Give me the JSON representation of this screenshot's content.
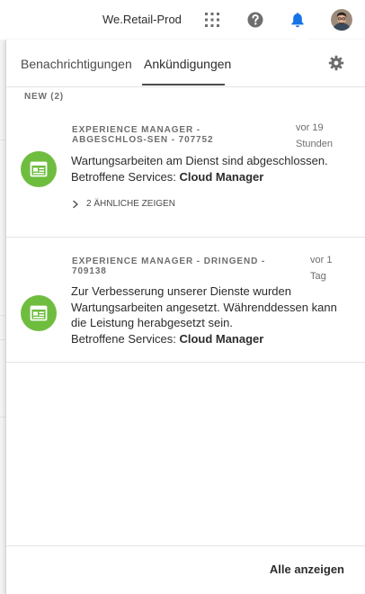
{
  "header": {
    "org_name": "We.Retail-Prod",
    "icons": [
      "apps-grid-icon",
      "help-icon",
      "bell-icon",
      "user-avatar"
    ],
    "bell_color": "#1473e6"
  },
  "popover": {
    "tabs": [
      {
        "label": "Benachrichtigungen",
        "active": false
      },
      {
        "label": "Ankündigungen",
        "active": true
      }
    ],
    "settings_icon": "gear-icon",
    "section_label": "NEW (2)",
    "notifications": [
      {
        "title": "EXPERIENCE MANAGER - ABGESCHLOS-SEN - 707752",
        "time": "vor 19 Stunden",
        "message": "Wartungsarbeiten am Dienst sind abgeschlossen.",
        "services_label": "Betroffene Services: ",
        "services_value": "Cloud Manager",
        "similar_label": "2 ÄHNLICHE ZEIGEN",
        "icon": "announcement-icon"
      },
      {
        "title": "EXPERIENCE MANAGER - DRINGEND - 709138",
        "time": "vor 1 Tag",
        "message": "Zur Verbesserung unserer Dienste wurden Wartungsarbeiten angesetzt. Währenddessen kann die Leistung herabgesetzt sein.",
        "services_label": "Betroffene Services: ",
        "services_value": "Cloud Manager",
        "icon": "announcement-icon"
      }
    ],
    "footer": {
      "view_all_label": "Alle anzeigen"
    },
    "icon_color": "#6fbd3f"
  }
}
